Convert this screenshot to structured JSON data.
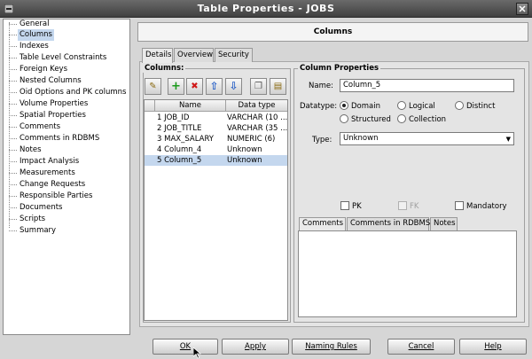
{
  "window": {
    "title": "Table Properties - JOBS"
  },
  "nav": {
    "items": [
      {
        "label": "General",
        "selected": false
      },
      {
        "label": "Columns",
        "selected": true
      },
      {
        "label": "Indexes",
        "selected": false
      },
      {
        "label": "Table Level Constraints",
        "selected": false
      },
      {
        "label": "Foreign Keys",
        "selected": false
      },
      {
        "label": "Nested Columns",
        "selected": false
      },
      {
        "label": "Oid Options and PK columns",
        "selected": false
      },
      {
        "label": "Volume Properties",
        "selected": false
      },
      {
        "label": "Spatial Properties",
        "selected": false
      },
      {
        "label": "Comments",
        "selected": false
      },
      {
        "label": "Comments in RDBMS",
        "selected": false
      },
      {
        "label": "Notes",
        "selected": false
      },
      {
        "label": "Impact Analysis",
        "selected": false
      },
      {
        "label": "Measurements",
        "selected": false
      },
      {
        "label": "Change Requests",
        "selected": false
      },
      {
        "label": "Responsible Parties",
        "selected": false
      },
      {
        "label": "Documents",
        "selected": false
      },
      {
        "label": "Scripts",
        "selected": false
      },
      {
        "label": "Summary",
        "selected": false
      }
    ]
  },
  "panel": {
    "title": "Columns"
  },
  "tabs": [
    {
      "label": "Details",
      "active": true
    },
    {
      "label": "Overview",
      "active": false
    },
    {
      "label": "Security",
      "active": false
    }
  ],
  "columns_section": {
    "label": "Columns:",
    "toolbar": [
      {
        "name": "edit-icon",
        "glyph": "✎"
      },
      {
        "name": "add-icon",
        "glyph": "+"
      },
      {
        "name": "delete-icon",
        "glyph": "✖"
      },
      {
        "name": "move-up-icon",
        "glyph": "⇧"
      },
      {
        "name": "move-down-icon",
        "glyph": "⇩"
      },
      {
        "name": "copy-icon",
        "glyph": "❐"
      },
      {
        "name": "paste-icon",
        "glyph": "▤"
      }
    ],
    "headers": [
      "Name",
      "Data type"
    ],
    "rows": [
      {
        "name": "1 JOB_ID",
        "type": "VARCHAR (10 ...",
        "selected": false
      },
      {
        "name": "2 JOB_TITLE",
        "type": "VARCHAR (35 ...",
        "selected": false
      },
      {
        "name": "3 MAX_SALARY",
        "type": "NUMERIC (6)",
        "selected": false
      },
      {
        "name": "4 Column_4",
        "type": "Unknown",
        "selected": false
      },
      {
        "name": "5 Column_5",
        "type": "Unknown",
        "selected": true
      }
    ]
  },
  "properties": {
    "label": "Column Properties",
    "name_label": "Name:",
    "name_value": "Column_5",
    "datatype_label": "Datatype:",
    "datatype_options": [
      {
        "label": "Domain",
        "checked": true
      },
      {
        "label": "Logical",
        "checked": false
      },
      {
        "label": "Distinct",
        "checked": false
      },
      {
        "label": "Structured",
        "checked": false
      },
      {
        "label": "Collection",
        "checked": false
      }
    ],
    "type_label": "Type:",
    "type_value": "Unknown",
    "pk_label": "PK",
    "fk_label": "FK",
    "mandatory_label": "Mandatory",
    "subtabs": [
      "Comments",
      "Comments in RDBMS",
      "Notes"
    ]
  },
  "footer": {
    "ok": "OK",
    "apply": "Apply",
    "naming_rules": "Naming Rules",
    "cancel": "Cancel",
    "help": "Help"
  },
  "colors": {
    "selection": "#c4d7ee",
    "titlebar": "#505050"
  }
}
